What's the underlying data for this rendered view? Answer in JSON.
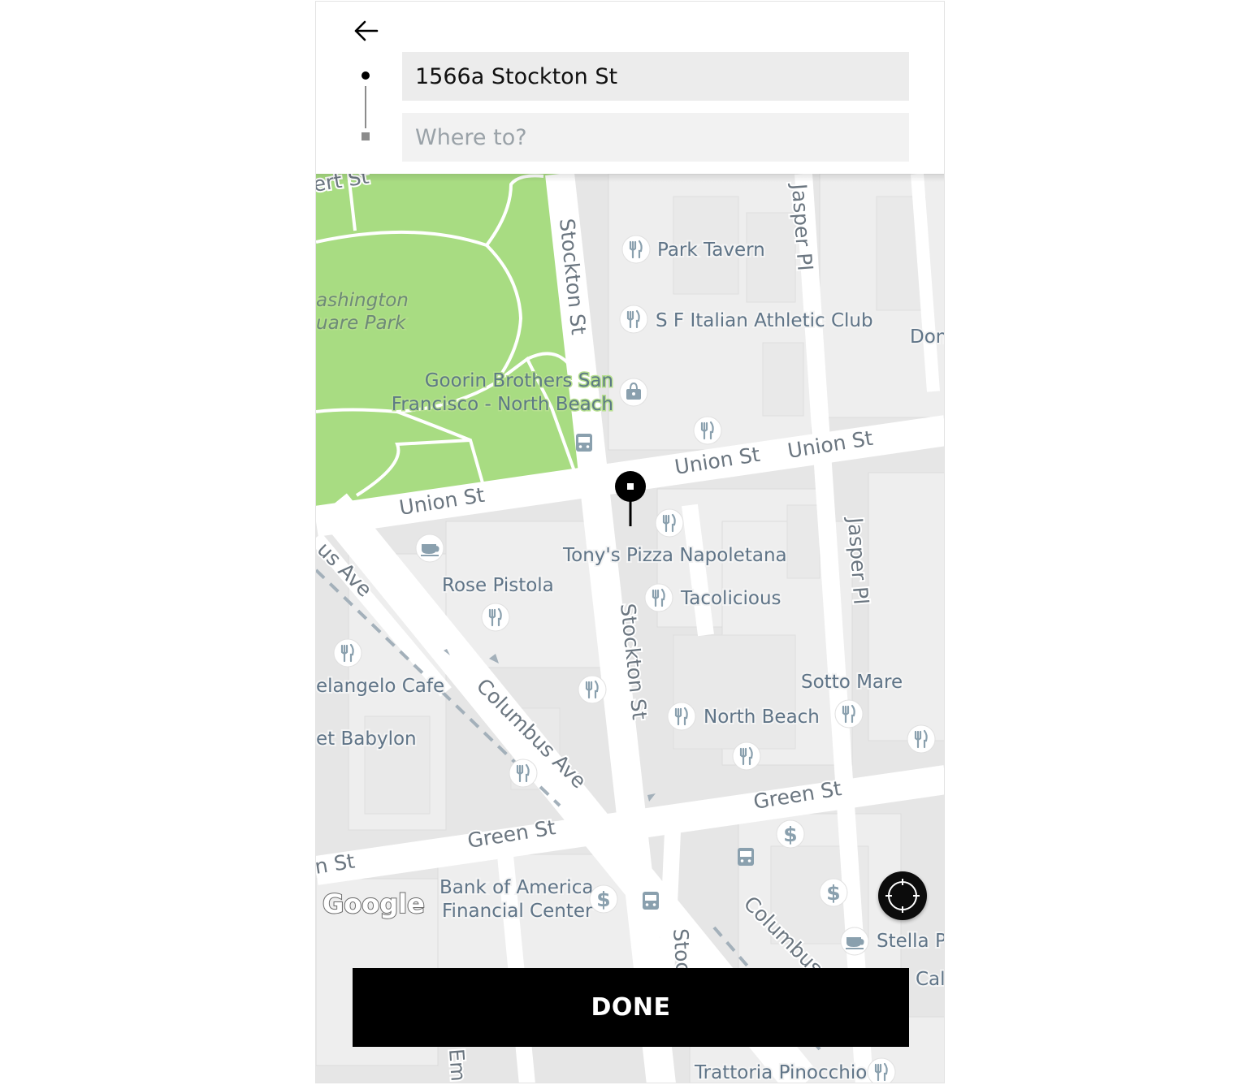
{
  "header": {
    "pickup_value": "1566a Stockton St",
    "dropoff_placeholder": "Where to?"
  },
  "map": {
    "streets": {
      "stockton_top": "Stockton St",
      "stockton_mid": "Stockton St",
      "stockton_bottom": "Stoc",
      "jasper_top": "Jasper Pl",
      "jasper_mid": "Jasper Pl",
      "union_left": "Union St",
      "union_mid": "Union St",
      "union_right": "Union St",
      "columbus_main": "Columbus Ave",
      "columbus_left": "us Ave",
      "columbus_bottom": "Columbus",
      "green_left": "Green St",
      "green_right": "Green St",
      "green_edge": "n St",
      "filbert_edge": "ert St",
      "emmet": "Em"
    },
    "places": {
      "park_line1": "ashington",
      "park_line2": "uare Park",
      "park_tavern": "Park Tavern",
      "italian_club": "S F Italian Athletic Club",
      "don": "Don",
      "goorin_line1": "Goorin Brothers San",
      "goorin_line2": "Francisco - North Beach",
      "tonys": "Tony's Pizza Napoletana",
      "rose_pistola": "Rose Pistola",
      "tacolicious": "Tacolicious",
      "michelangelo": "elangelo Cafe",
      "babylon": "et Babylon",
      "sotto_mare": "Sotto Mare",
      "north_beach": "North Beach",
      "bofa_line1": "Bank of America",
      "bofa_line2": "Financial Center",
      "stella": "Stella Pa",
      "cal": "Cal",
      "trattoria": "Trattoria Pinocchio"
    },
    "google_logo": "Google",
    "colors": {
      "park": "#a8dc82",
      "roads": "#ffffff",
      "blocks": "#e6e6e6",
      "poi_text": "#5f7487"
    }
  },
  "actions": {
    "done_label": "DONE"
  }
}
